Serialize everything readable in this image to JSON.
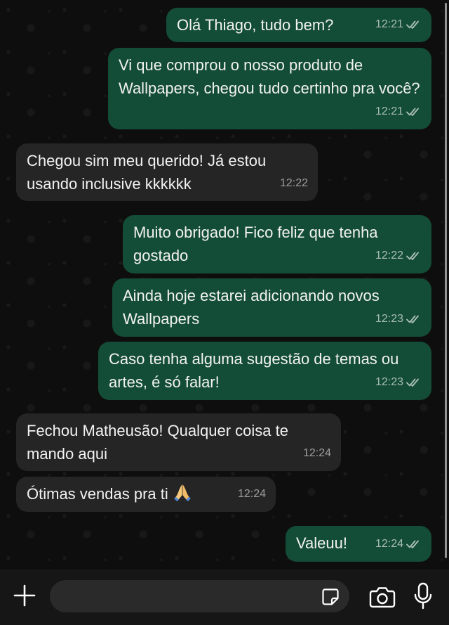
{
  "messages": [
    {
      "direction": "out",
      "text": "Olá Thiago, tudo bem?",
      "time": "12:21",
      "status": "read-double-check-icon"
    },
    {
      "direction": "out",
      "text": "Vi que comprou o nosso produto de Wallpapers, chegou tudo certinho pra você?",
      "time": "12:21",
      "status": "read-double-check-icon"
    },
    {
      "direction": "in",
      "text": "Chegou sim meu querido! Já estou usando inclusive kkkkkk",
      "time": "12:22"
    },
    {
      "direction": "out",
      "text": "Muito obrigado! Fico feliz que tenha gostado",
      "time": "12:22",
      "status": "read-double-check-icon"
    },
    {
      "direction": "out",
      "text": "Ainda hoje estarei adicionando novos Wallpapers",
      "time": "12:23",
      "status": "read-double-check-icon"
    },
    {
      "direction": "out",
      "text": "Caso tenha alguma sugestão de temas ou artes, é só falar!",
      "time": "12:23",
      "status": "read-double-check-icon"
    },
    {
      "direction": "in",
      "text": "Fechou Matheusão! Qualquer coisa te mando aqui",
      "time": "12:24"
    },
    {
      "direction": "in",
      "text": "Ótimas vendas pra ti",
      "emoji": "folded-hands-emoji",
      "time": "12:24"
    },
    {
      "direction": "out",
      "text": "Valeuu!",
      "time": "12:24",
      "status": "read-double-check-icon"
    }
  ],
  "composer": {
    "input_value": "",
    "icons": [
      "plus-icon",
      "sticker-icon",
      "camera-icon",
      "microphone-icon"
    ]
  },
  "colors": {
    "outgoing_bubble": "#144d37",
    "incoming_bubble": "#252525",
    "chat_background": "#0e0e0e",
    "bottom_bar": "#161616",
    "input_background": "#2a2a2a"
  }
}
